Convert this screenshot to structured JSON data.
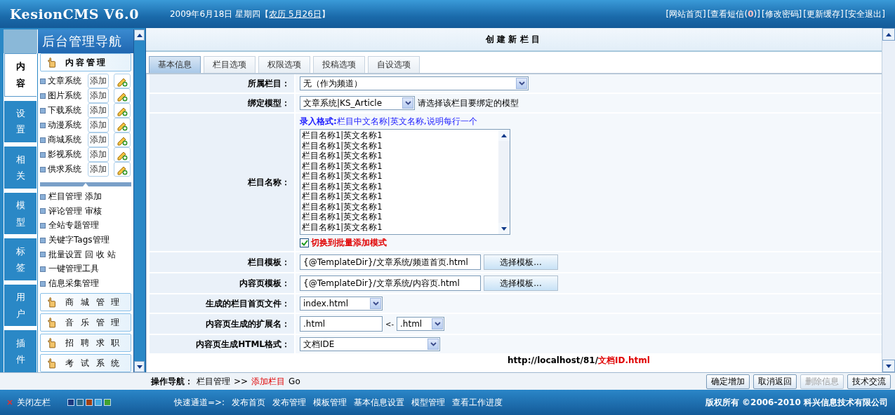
{
  "header": {
    "logo": "KesionCMS V6.0",
    "date": "2009年6月18日  星期四【",
    "lunar": "农历 5月26日",
    "date_end": "】",
    "links": [
      {
        "text": "[网站首页]"
      },
      {
        "text": "[查看短信(",
        "count": "0",
        "after": ")]"
      },
      {
        "text": "[修改密码]"
      },
      {
        "text": "[更新缓存]"
      },
      {
        "text": "[安全退出]"
      }
    ]
  },
  "sidebar": {
    "title": "后台管理导航",
    "tabs": [
      {
        "label": "内容",
        "selected": true
      },
      {
        "label": "设置",
        "selected": false
      },
      {
        "label": "相关",
        "selected": false
      },
      {
        "label": "模型",
        "selected": false
      },
      {
        "label": "标签",
        "selected": false
      },
      {
        "label": "用户",
        "selected": false
      },
      {
        "label": "插件",
        "selected": false
      }
    ],
    "section": "内容管理",
    "systems": [
      {
        "name": "文章系统",
        "button": "添加"
      },
      {
        "name": "图片系统",
        "button": "添加"
      },
      {
        "name": "下载系统",
        "button": "添加"
      },
      {
        "name": "动漫系统",
        "button": "添加"
      },
      {
        "name": "商城系统",
        "button": "添加"
      },
      {
        "name": "影视系统",
        "button": "添加"
      },
      {
        "name": "供求系统",
        "button": "添加"
      }
    ],
    "links": [
      {
        "parts": [
          "栏目管理",
          "添加"
        ]
      },
      {
        "parts": [
          "评论管理",
          "审核"
        ]
      },
      {
        "parts": [
          "全站专题管理"
        ]
      },
      {
        "parts": [
          "关键字Tags管理"
        ]
      },
      {
        "parts": [
          "批量设置",
          "回 收 站"
        ]
      },
      {
        "parts": [
          "一键管理工具"
        ]
      },
      {
        "parts": [
          "信息采集管理"
        ]
      }
    ],
    "collapsed": [
      "商 城 管 理",
      "音 乐 管 理",
      "招 聘 求 职",
      "考 试 系 统"
    ]
  },
  "main": {
    "title": "创 建 新 栏 目",
    "tabs": [
      {
        "label": "基本信息",
        "selected": true
      },
      {
        "label": "栏目选项",
        "selected": false
      },
      {
        "label": "权限选项",
        "selected": false
      },
      {
        "label": "投稿选项",
        "selected": false
      },
      {
        "label": "自设选项",
        "selected": false
      }
    ],
    "rows": [
      {
        "kind": "select",
        "label": "所属栏目：",
        "value": "无（作为频道）"
      },
      {
        "kind": "select",
        "label": "绑定模型：",
        "value": "文章系统|KS_Article",
        "hint": "请选择该栏目要绑定的模型"
      },
      {
        "kind": "textarea",
        "label": "栏目名称：",
        "format": "**录入格式:**栏目中文名称|英文名称,说明每行一个",
        "lines": [
          "栏目名称1|英文名称1",
          "栏目名称1|英文名称1",
          "栏目名称1|英文名称1",
          "栏目名称1|英文名称1",
          "栏目名称1|英文名称1",
          "栏目名称1|英文名称1",
          "栏目名称1|英文名称1",
          "栏目名称1|英文名称1",
          "栏目名称1|英文名称1",
          "栏目名称1|英文名称1"
        ],
        "checkbox": {
          "label": "切换到批量添加模式",
          "checked": true
        }
      },
      {
        "kind": "template",
        "label": "栏目模板：",
        "value": "{@TemplateDir}/文章系统/频道首页.html",
        "button": "选择模板..."
      },
      {
        "kind": "template",
        "label": "内容页模板：",
        "value": "{@TemplateDir}/文章系统/内容页.html",
        "button": "选择模板..."
      },
      {
        "kind": "select",
        "label": "生成的栏目首页文件：",
        "value": "index.html"
      },
      {
        "kind": "ext",
        "label": "内容页生成的扩展名：",
        "value": ".html",
        "arrow": "<-",
        "option": ".html"
      },
      {
        "kind": "select",
        "label": "内容页生成HTML格式：",
        "value": "文档IDE"
      }
    ],
    "url": "http://localhost/81/",
    "url_highlight": "文档ID.html"
  },
  "action_bar": {
    "label": "操作导航：",
    "crumb": "栏目管理",
    "sep": ">>",
    "current": "添加栏目",
    "go": "Go",
    "buttons": [
      {
        "label": "确定增加",
        "disabled": false
      },
      {
        "label": "取消返回",
        "disabled": false
      },
      {
        "label": "删除信息",
        "disabled": true
      },
      {
        "label": "技术交流",
        "disabled": false
      }
    ]
  },
  "footer": {
    "close": "关闭左栏",
    "swatches": [
      {
        "color": "#1a3a80"
      },
      {
        "color": "#2a6a8a"
      },
      {
        "color": "#a04010"
      },
      {
        "color": "#40a8e0"
      },
      {
        "color": "#40a030"
      }
    ],
    "quick_label": "快速通道=>:",
    "quick_links": [
      "发布首页",
      "发布管理",
      "模板管理",
      "基本信息设置",
      "模型管理",
      "查看工作进度"
    ],
    "copyright": "版权所有 ©2006-2010 科兴信息技术有限公司"
  }
}
